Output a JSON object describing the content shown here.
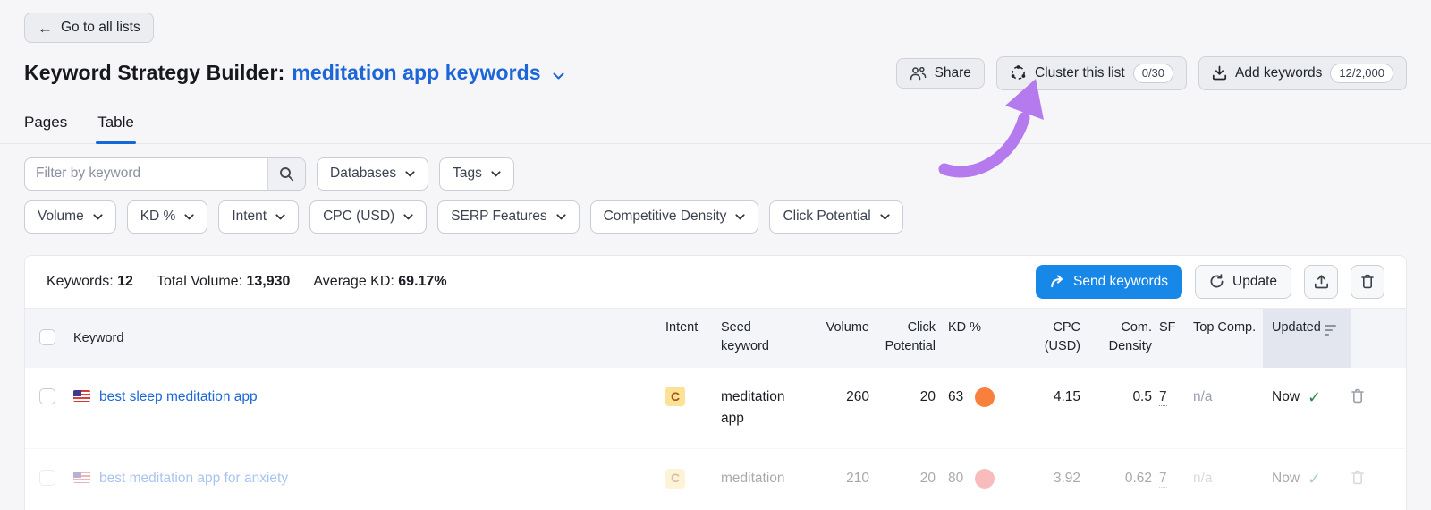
{
  "page": {
    "back_label": "Go to all lists"
  },
  "header": {
    "title_prefix": "Keyword Strategy Builder:",
    "list_name": "meditation app keywords",
    "share_label": "Share",
    "cluster_label": "Cluster this list",
    "cluster_counter": "0/30",
    "add_keywords_label": "Add keywords",
    "add_keywords_counter": "12/2,000"
  },
  "tabs": {
    "pages": "Pages",
    "table": "Table"
  },
  "filters": {
    "keyword_placeholder": "Filter by keyword",
    "databases": "Databases",
    "tags": "Tags",
    "volume": "Volume",
    "kd": "KD %",
    "intent": "Intent",
    "cpc": "CPC (USD)",
    "serp_features": "SERP Features",
    "competitive_density": "Competitive Density",
    "click_potential": "Click Potential"
  },
  "stats": {
    "keywords_label": "Keywords:",
    "keywords_value": "12",
    "volume_label": "Total Volume:",
    "volume_value": "13,930",
    "kd_label": "Average KD:",
    "kd_value": "69.17%",
    "send_label": "Send keywords",
    "update_label": "Update"
  },
  "table": {
    "columns": {
      "keyword": "Keyword",
      "intent": "Intent",
      "seed": "Seed keyword",
      "volume": "Volume",
      "click": "Click Potential",
      "kd": "KD %",
      "cpc": "CPC (USD)",
      "com": "Com. Density",
      "sf": "SF",
      "top": "Top Comp.",
      "updated": "Updated"
    },
    "rows": [
      {
        "keyword": "best sleep meditation app",
        "intent": "C",
        "seed": "meditation app",
        "volume": "260",
        "click": "20",
        "kd": "63",
        "cpc": "4.15",
        "com": "0.5",
        "sf": "7",
        "top": "n/a",
        "updated": "Now"
      },
      {
        "keyword": "best meditation app for anxiety",
        "intent": "C",
        "seed": "meditation",
        "volume": "210",
        "click": "20",
        "kd": "80",
        "cpc": "3.92",
        "com": "0.62",
        "sf": "7",
        "top": "n/a",
        "updated": "Now"
      }
    ]
  },
  "colors": {
    "accent_blue": "#1c66d8",
    "button_blue": "#1787e8",
    "kd_dot_row1": "#f9803c",
    "kd_dot_row2": "#ee5253",
    "intent_badge_bg": "#fbe294",
    "intent_badge_text": "#a3551b",
    "arrow_purple": "#b57bee",
    "check_green": "#1f8a50"
  }
}
